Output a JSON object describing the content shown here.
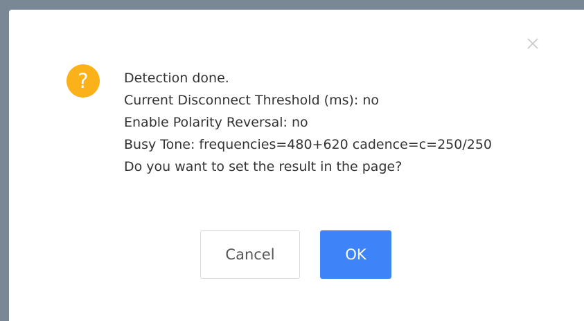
{
  "dialog": {
    "close_icon": "close-icon",
    "status_icon": "question-circle-icon",
    "status_icon_glyph": "?",
    "message_lines": [
      "Detection done.",
      "Current Disconnect Threshold (ms): no",
      "Enable Polarity Reversal: no",
      "Busy Tone: frequencies=480+620 cadence=c=250/250",
      "Do you want to set the result in the page?"
    ],
    "cancel_label": "Cancel",
    "ok_label": "OK"
  },
  "colors": {
    "backdrop": "#7a8794",
    "icon_warning": "#fbb11a",
    "primary": "#3f83f8",
    "text": "#333333"
  }
}
